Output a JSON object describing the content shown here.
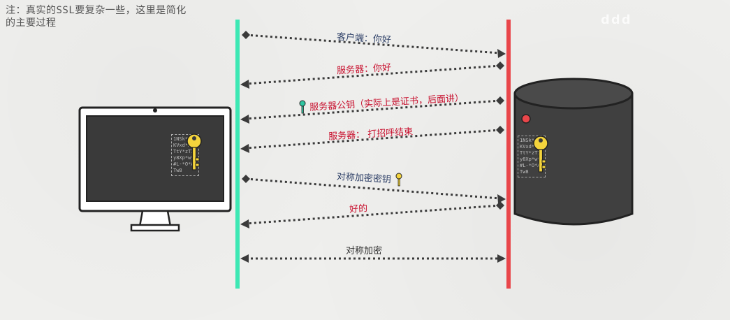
{
  "note": "注：真实的SSL要复杂一些，这里是简化的主要过程",
  "watermark": "ddd",
  "messages": [
    {
      "text": "客户端：你好",
      "color": "blue"
    },
    {
      "text": "服务器：你好",
      "color": "red"
    },
    {
      "text": "服务器公钥（实际上是证书，后面讲）",
      "color": "red"
    },
    {
      "text": "服务器： 打招呼结束",
      "color": "red"
    },
    {
      "text": "对称加密密钥",
      "color": "blue"
    },
    {
      "text": "好的",
      "color": "red"
    },
    {
      "text": "对称加密",
      "color": "dark"
    }
  ],
  "code_text": "1NSk**0\nKVxd*Dmy\nTtY*zT7-\ny8Xp*w*\n#L-*O*A\nTw8",
  "colors": {
    "client_line": "#3de8b4",
    "server_line": "#e9464a",
    "key_yellow": "#f4d43c",
    "key_teal": "#2ec6a2"
  },
  "icons": [
    "desktop-monitor-icon",
    "server-cylinder-icon",
    "key-icon"
  ]
}
